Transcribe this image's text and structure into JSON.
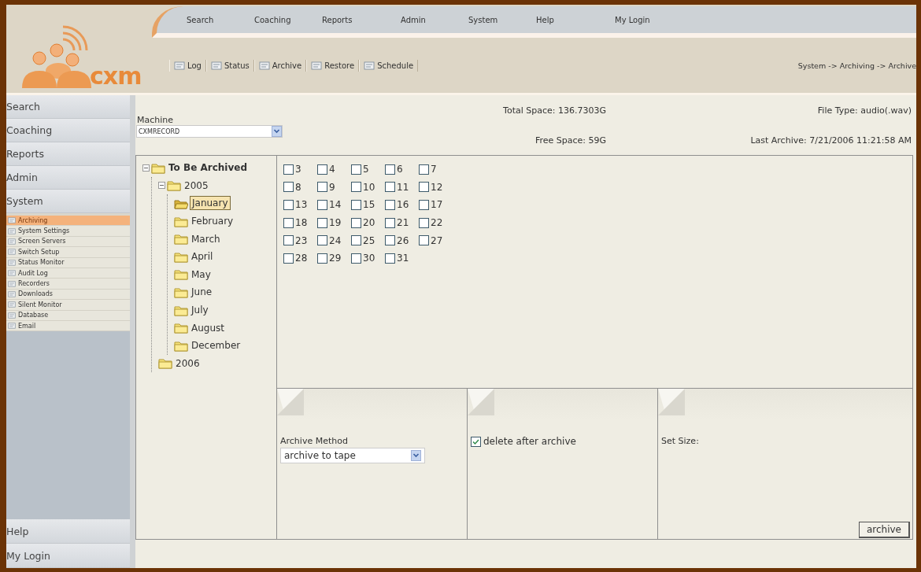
{
  "logo": {
    "text": "cxm"
  },
  "nav": [
    "Search",
    "Coaching",
    "Reports",
    "Admin",
    "System",
    "Help",
    "My Login"
  ],
  "toolbar": [
    "Log",
    "Status",
    "Archive",
    "Restore",
    "Schedule"
  ],
  "breadcrumb": "System -> Archiving -> Archive",
  "sidebar": {
    "sections": [
      "Search",
      "Coaching",
      "Reports",
      "Admin",
      "System"
    ],
    "items": [
      {
        "label": "Archiving",
        "selected": true
      },
      {
        "label": "System Settings",
        "selected": false
      },
      {
        "label": "Screen Servers",
        "selected": false
      },
      {
        "label": "Switch Setup",
        "selected": false
      },
      {
        "label": "Status Monitor",
        "selected": false
      },
      {
        "label": "Audit Log",
        "selected": false
      },
      {
        "label": "Recorders",
        "selected": false
      },
      {
        "label": "Downloads",
        "selected": false
      },
      {
        "label": "Silent Monitor",
        "selected": false
      },
      {
        "label": "Database",
        "selected": false
      },
      {
        "label": "Email",
        "selected": false
      }
    ],
    "footer": [
      "Help",
      "My Login"
    ]
  },
  "machine": {
    "label": "Machine",
    "value": "CXMRECORD"
  },
  "stats": {
    "total_space": "Total Space: 136.7303G",
    "file_type": "File Type: audio(.wav)",
    "free_space": "Free Space: 59G",
    "last_archive": "Last Archive: 7/21/2006 11:21:58 AM"
  },
  "tree": [
    {
      "label": "To Be Archived",
      "expanded": true,
      "selected": false,
      "children": [
        {
          "label": "2005",
          "expanded": true,
          "selected": false,
          "children": [
            {
              "label": "January",
              "selected": true
            },
            {
              "label": "February",
              "selected": false
            },
            {
              "label": "March",
              "selected": false
            },
            {
              "label": "April",
              "selected": false
            },
            {
              "label": "May",
              "selected": false
            },
            {
              "label": "June",
              "selected": false
            },
            {
              "label": "July",
              "selected": false
            },
            {
              "label": "August",
              "selected": false
            },
            {
              "label": "December",
              "selected": false
            }
          ]
        },
        {
          "label": "2006",
          "selected": false
        }
      ]
    }
  ],
  "days": [
    {
      "label": "3",
      "checked": false
    },
    {
      "label": "4",
      "checked": false
    },
    {
      "label": "5",
      "checked": false
    },
    {
      "label": "6",
      "checked": false
    },
    {
      "label": "7",
      "checked": false
    },
    {
      "label": "8",
      "checked": false
    },
    {
      "label": "9",
      "checked": false
    },
    {
      "label": "10",
      "checked": false
    },
    {
      "label": "11",
      "checked": false
    },
    {
      "label": "12",
      "checked": false
    },
    {
      "label": "13",
      "checked": false
    },
    {
      "label": "14",
      "checked": false
    },
    {
      "label": "15",
      "checked": false
    },
    {
      "label": "16",
      "checked": false
    },
    {
      "label": "17",
      "checked": false
    },
    {
      "label": "18",
      "checked": false
    },
    {
      "label": "19",
      "checked": false
    },
    {
      "label": "20",
      "checked": false
    },
    {
      "label": "21",
      "checked": false
    },
    {
      "label": "22",
      "checked": false
    },
    {
      "label": "23",
      "checked": false
    },
    {
      "label": "24",
      "checked": false
    },
    {
      "label": "25",
      "checked": false
    },
    {
      "label": "26",
      "checked": false
    },
    {
      "label": "27",
      "checked": false
    },
    {
      "label": "28",
      "checked": false
    },
    {
      "label": "29",
      "checked": false
    },
    {
      "label": "30",
      "checked": false
    },
    {
      "label": "31",
      "checked": false
    }
  ],
  "archive_method": {
    "label": "Archive Method",
    "value": "archive to tape"
  },
  "delete_after": {
    "label": "delete after archive",
    "checked": true
  },
  "set_size": {
    "label": "Set Size:"
  },
  "archive_button": "archive"
}
